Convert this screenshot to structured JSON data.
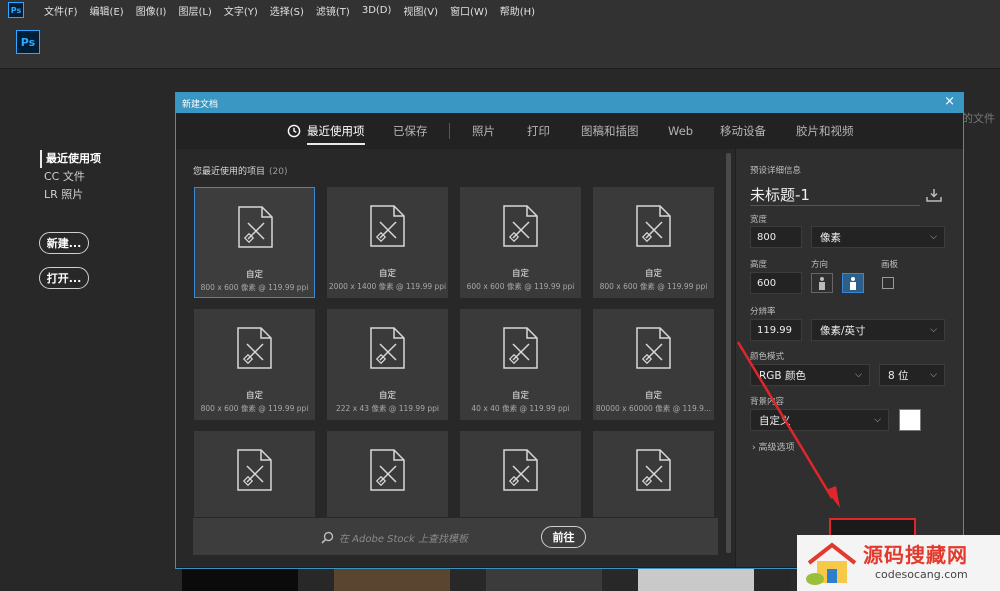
{
  "menubar": {
    "logo": "Ps",
    "items": [
      "文件(F)",
      "编辑(E)",
      "图像(I)",
      "图层(L)",
      "文字(Y)",
      "选择(S)",
      "滤镜(T)",
      "3D(D)",
      "视图(V)",
      "窗口(W)",
      "帮助(H)"
    ]
  },
  "app": {
    "logo": "Ps"
  },
  "start": {
    "nav": [
      "最近使用项",
      "CC 文件",
      "LR 照片"
    ],
    "new_label": "新建...",
    "open_label": "打开...",
    "bg_hint": "的文件"
  },
  "dialog": {
    "title": "新建文档",
    "close": "×",
    "tabs": [
      "最近使用项",
      "已保存",
      "照片",
      "打印",
      "图稿和插图",
      "Web",
      "移动设备",
      "胶片和视频"
    ],
    "recent_label": "您最近使用的项目",
    "recent_count": "(20)",
    "cards": [
      {
        "name": "自定",
        "desc": "800 x 600 像素 @ 119.99 ppi"
      },
      {
        "name": "自定",
        "desc": "2000 x 1400 像素 @ 119.99 ppi"
      },
      {
        "name": "自定",
        "desc": "600 x 600 像素 @ 119.99 ppi"
      },
      {
        "name": "自定",
        "desc": "800 x 600 像素 @ 119.99 ppi"
      },
      {
        "name": "自定",
        "desc": "800 x 600 像素 @ 119.99 ppi"
      },
      {
        "name": "自定",
        "desc": "222 x 43 像素 @ 119.99 ppi"
      },
      {
        "name": "自定",
        "desc": "40 x 40 像素 @ 119.99 ppi"
      },
      {
        "name": "自定",
        "desc": "80000 x 60000 像素 @ 119.9..."
      },
      {
        "name": "",
        "desc": ""
      },
      {
        "name": "",
        "desc": ""
      },
      {
        "name": "",
        "desc": ""
      },
      {
        "name": "",
        "desc": ""
      }
    ],
    "stock_placeholder": "在 Adobe Stock 上查找模板",
    "stock_go": "前往",
    "details": {
      "heading": "预设详细信息",
      "name": "未标题-1",
      "width_label": "宽度",
      "width_value": "800",
      "width_unit": "像素",
      "height_label": "高度",
      "height_value": "600",
      "orientation_label": "方向",
      "artboard_label": "画板",
      "resolution_label": "分辨率",
      "resolution_value": "119.99",
      "resolution_unit": "像素/英寸",
      "color_mode_label": "颜色模式",
      "color_mode_value": "RGB 颜色",
      "bit_depth_value": "8 位",
      "bg_label": "背景内容",
      "bg_value": "自定义",
      "bg_color": "#ffffff",
      "advanced_label": "高级选项"
    }
  },
  "watermark": {
    "title": "源码搜藏网",
    "url": "codesocang.com"
  },
  "colors": {
    "accent": "#3a97c3",
    "selection": "#3a87d6",
    "annotation": "#e0262b"
  }
}
